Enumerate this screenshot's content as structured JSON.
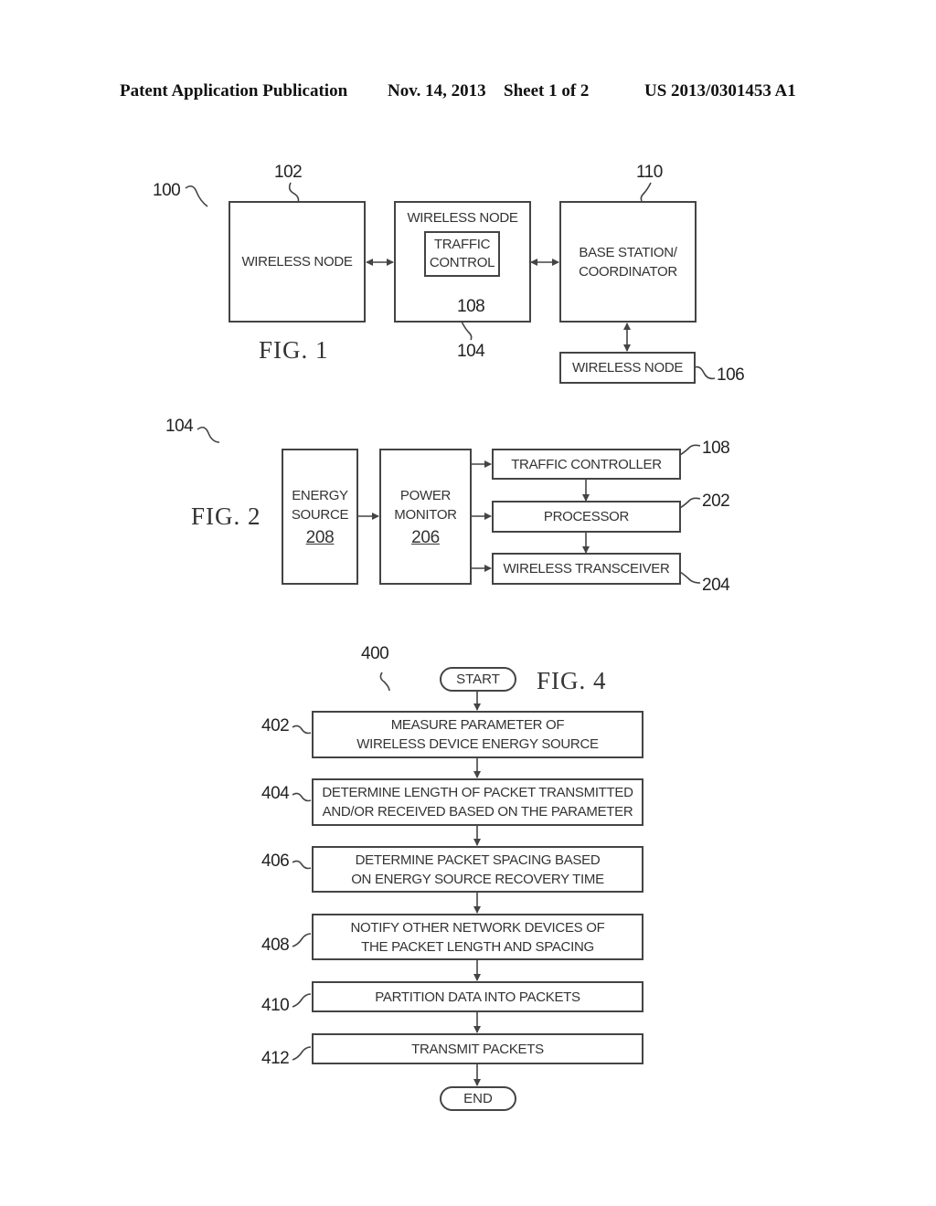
{
  "header": {
    "publication": "Patent Application Publication",
    "date": "Nov. 14, 2013",
    "sheet": "Sheet 1 of 2",
    "number": "US 2013/0301453 A1"
  },
  "fig1": {
    "title": "FIG. 1",
    "ref": "100",
    "nodes": [
      {
        "id": "102",
        "label": "WIRELESS NODE"
      },
      {
        "id": "104",
        "label": "WIRELESS NODE",
        "inner": {
          "id": "108",
          "label_line1": "TRAFFIC",
          "label_line2": "CONTROL"
        }
      },
      {
        "id": "110",
        "label_line1": "BASE STATION/",
        "label_line2": "COORDINATOR"
      },
      {
        "id": "106",
        "label": "WIRELESS NODE"
      }
    ]
  },
  "fig2": {
    "title": "FIG. 2",
    "ref": "104",
    "energy_source": {
      "line1": "ENERGY",
      "line2": "SOURCE",
      "id": "208"
    },
    "power_monitor": {
      "line1": "POWER",
      "line2": "MONITOR",
      "id": "206"
    },
    "blocks": [
      {
        "id": "108",
        "label": "TRAFFIC CONTROLLER"
      },
      {
        "id": "202",
        "label": "PROCESSOR"
      },
      {
        "id": "204",
        "label": "WIRELESS TRANSCEIVER"
      }
    ]
  },
  "fig4": {
    "title": "FIG. 4",
    "ref": "400",
    "start": "START",
    "end": "END",
    "steps": [
      {
        "id": "402",
        "line1": "MEASURE PARAMETER OF",
        "line2": "WIRELESS DEVICE ENERGY SOURCE"
      },
      {
        "id": "404",
        "line1": "DETERMINE LENGTH OF PACKET TRANSMITTED",
        "line2": "AND/OR RECEIVED BASED ON THE PARAMETER"
      },
      {
        "id": "406",
        "line1": "DETERMINE PACKET SPACING BASED",
        "line2": "ON ENERGY SOURCE RECOVERY TIME"
      },
      {
        "id": "408",
        "line1": "NOTIFY OTHER NETWORK DEVICES OF",
        "line2": "THE PACKET LENGTH AND SPACING"
      },
      {
        "id": "410",
        "line1": "PARTITION DATA INTO PACKETS"
      },
      {
        "id": "412",
        "line1": "TRANSMIT PACKETS"
      }
    ]
  }
}
